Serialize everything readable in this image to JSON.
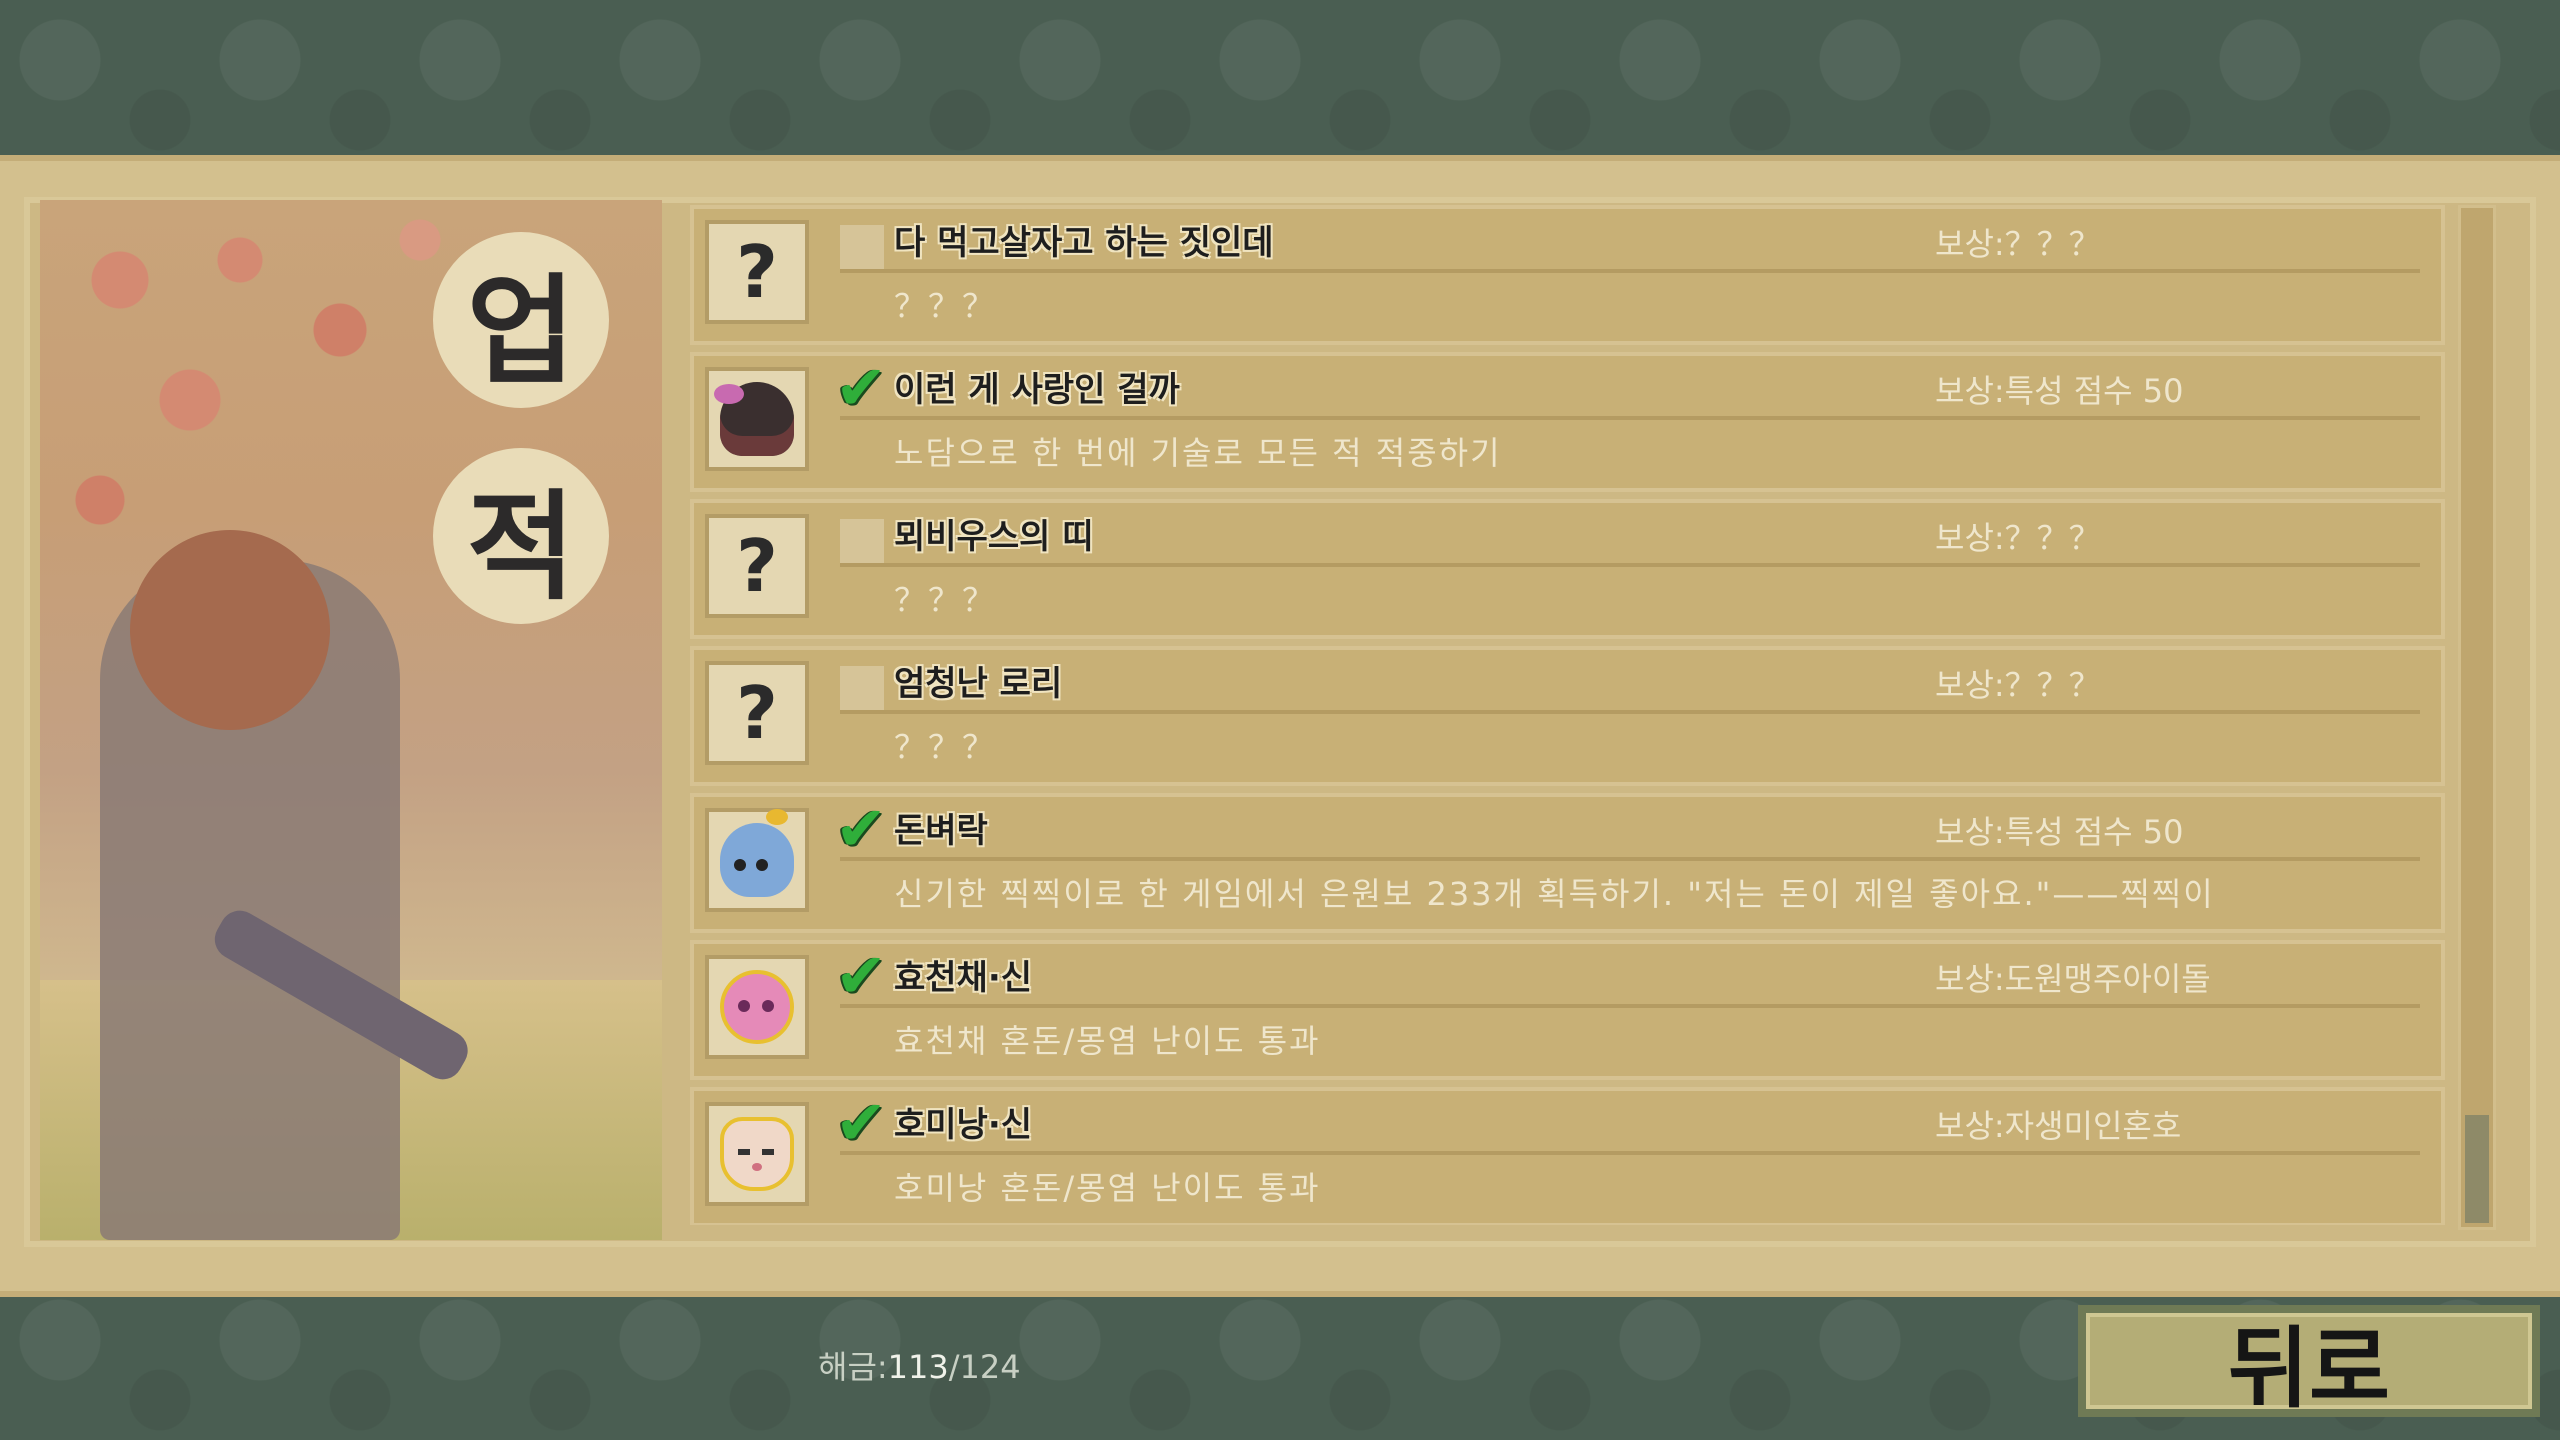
{
  "title": {
    "char1": "업",
    "char2": "적"
  },
  "achievements": [
    {
      "icon": "question-mark-icon",
      "unlocked": false,
      "name": "다 먹고살자고 하는 짓인데",
      "reward": "보상:？？？",
      "desc": "？？？"
    },
    {
      "icon": "ninja-character-icon",
      "unlocked": true,
      "name": "이런 게 사랑인 걸까",
      "reward": "보상:특성 점수 50",
      "desc": "노담으로 한 번에 기술로 모든 적 적중하기"
    },
    {
      "icon": "question-mark-icon",
      "unlocked": false,
      "name": "뫼비우스의 띠",
      "reward": "보상:？？？",
      "desc": "？？？"
    },
    {
      "icon": "question-mark-icon",
      "unlocked": false,
      "name": "엄청난 로리",
      "reward": "보상:？？？",
      "desc": "？？？"
    },
    {
      "icon": "blue-bird-icon",
      "unlocked": true,
      "name": "돈벼락",
      "reward": "보상:특성 점수 50",
      "desc": "신기한 찍찍이로 한 게임에서 은원보 233개 획득하기. \"저는 돈이 제일 좋아요.\"——찍찍이"
    },
    {
      "icon": "pink-bear-girl-icon",
      "unlocked": true,
      "name": "효천채·신",
      "reward": "보상:도원맹주아이돌",
      "desc": "효천채 혼돈/몽염 난이도 통과"
    },
    {
      "icon": "fox-face-icon",
      "unlocked": true,
      "name": "호미낭·신",
      "reward": "보상:자생미인혼호",
      "desc": "호미낭 혼돈/몽염 난이도 통과"
    }
  ],
  "question_glyph": "?",
  "check_glyph": "✔",
  "footer": {
    "unlock_label": "해금:",
    "unlocked_count": "113",
    "total": "/124",
    "back_button": "뒤로"
  },
  "scroll": {
    "position_fraction": 1.0
  }
}
